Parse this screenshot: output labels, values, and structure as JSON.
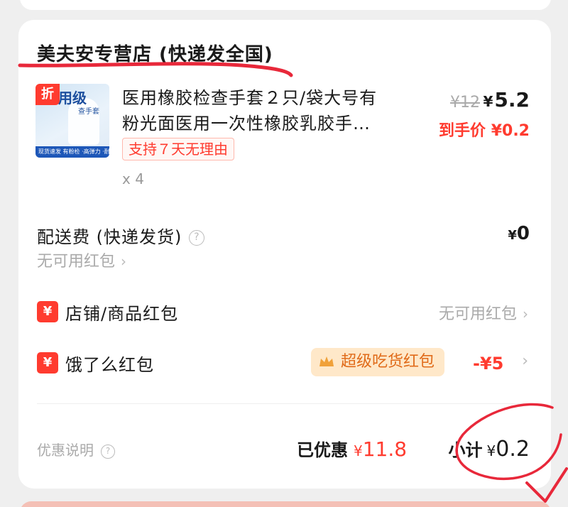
{
  "store": {
    "name": "美夫安专营店 (快递发全国)"
  },
  "product": {
    "thumb_badge": "折",
    "thumb_title": "用级",
    "thumb_subtitle": "查手套",
    "thumb_bar": "现货速发 有粉检 ·高弹力 ·耐拉伸",
    "title_line1": "医用橡胶检查手套２只/袋大号有",
    "title_line2": "粉光面医用一次性橡胶乳胶手…",
    "return_tag": "支持７天无理由",
    "quantity": "x 4",
    "original_price": "¥12",
    "currency": "¥",
    "current_price": "5.2",
    "final_price_label": "到手价 ¥0.2"
  },
  "shipping": {
    "label": "配送费 (快递发货)",
    "help": "?",
    "currency": "¥",
    "value": "0",
    "note": "无可用红包"
  },
  "store_coupon": {
    "icon": "¥",
    "label": "店铺/商品红包",
    "value": "无可用红包"
  },
  "eleme_coupon": {
    "icon": "¥",
    "label": "饿了么红包",
    "tag": "超级吃货红包",
    "discount": "-¥5"
  },
  "summary": {
    "promo_note": "优惠说明",
    "help": "?",
    "saved_label": "已优惠",
    "saved_currency": "¥",
    "saved_amount": "11.8",
    "subtotal_label": "小计",
    "subtotal_currency": "¥",
    "subtotal_amount": "0.2"
  },
  "colors": {
    "accent": "#ff3b2f",
    "annotation": "#e8283a",
    "tag_bg": "#ffe8c9",
    "tag_text": "#e06b1a"
  },
  "icons": {
    "chevron": "chevron-right-icon",
    "crown": "crown-icon",
    "help": "help-circle-icon"
  }
}
